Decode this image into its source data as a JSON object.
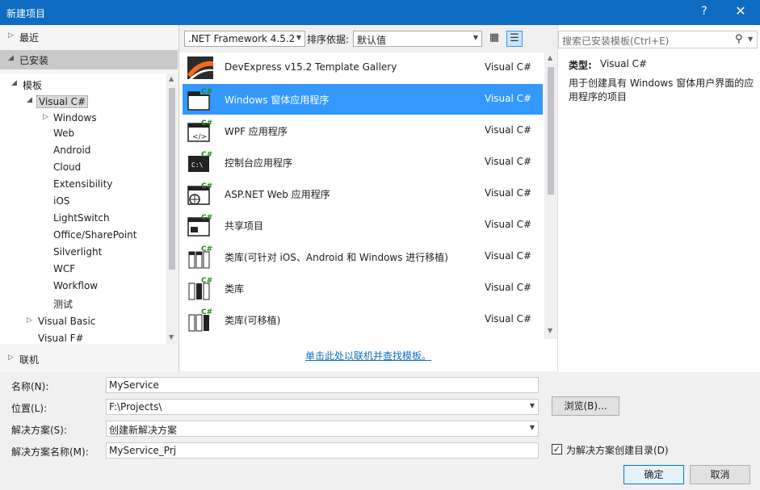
{
  "window": {
    "title": "新建项目",
    "help": "?",
    "close": "✕"
  },
  "left": {
    "recent": "最近",
    "installed": "已安装",
    "online": "联机",
    "tree": {
      "templates": "模板",
      "visual_csharp": "Visual C#",
      "children": [
        "Windows",
        "Web",
        "Android",
        "Cloud",
        "Extensibility",
        "iOS",
        "LightSwitch",
        "Office/SharePoint",
        "Silverlight",
        "WCF",
        "Workflow",
        "测试"
      ],
      "visual_basic": "Visual Basic",
      "visual_fsharp": "Visual F#"
    }
  },
  "toolbar": {
    "framework": ".NET Framework 4.5.2",
    "sort_label": "排序依据:",
    "sort_value": "默认值"
  },
  "templates": [
    {
      "name": "DevExpress v15.2 Template Gallery",
      "lang": "Visual C#",
      "icon": "devexpress-icon"
    },
    {
      "name": "Windows 窗体应用程序",
      "lang": "Visual C#",
      "icon": "windows-form-icon"
    },
    {
      "name": "WPF 应用程序",
      "lang": "Visual C#",
      "icon": "wpf-icon"
    },
    {
      "name": "控制台应用程序",
      "lang": "Visual C#",
      "icon": "console-icon"
    },
    {
      "name": "ASP.NET Web 应用程序",
      "lang": "Visual C#",
      "icon": "web-icon"
    },
    {
      "name": "共享项目",
      "lang": "Visual C#",
      "icon": "shared-project-icon"
    },
    {
      "name": "类库(可针对 iOS、Android 和 Windows 进行移植)",
      "lang": "Visual C#",
      "icon": "portable-library-icon"
    },
    {
      "name": "类库",
      "lang": "Visual C#",
      "icon": "class-library-icon"
    },
    {
      "name": "类库(可移植)",
      "lang": "Visual C#",
      "icon": "portable-class-library-icon"
    }
  ],
  "online_link": "单击此处以联机并查找模板。",
  "right": {
    "search_placeholder": "搜索已安装模板(Ctrl+E)",
    "type_label": "类型:",
    "type_value": "Visual C#",
    "description": "用于创建具有 Windows 窗体用户界面的应用程序的项目"
  },
  "form": {
    "name_label": "名称(N):",
    "name_value": "MyService",
    "location_label": "位置(L):",
    "location_value": "F:\\Projects\\",
    "browse": "浏览(B)...",
    "solution_label": "解决方案(S):",
    "solution_value": "创建新解决方案",
    "solution_name_label": "解决方案名称(M):",
    "solution_name_value": "MyService_Prj",
    "create_dir_label": "为解决方案创建目录(D)",
    "create_dir_checked": true,
    "ok": "确定",
    "cancel": "取消"
  },
  "colors": {
    "titlebar": "#0e6cc2",
    "selection": "#3399ff",
    "link": "#0e70c0"
  }
}
